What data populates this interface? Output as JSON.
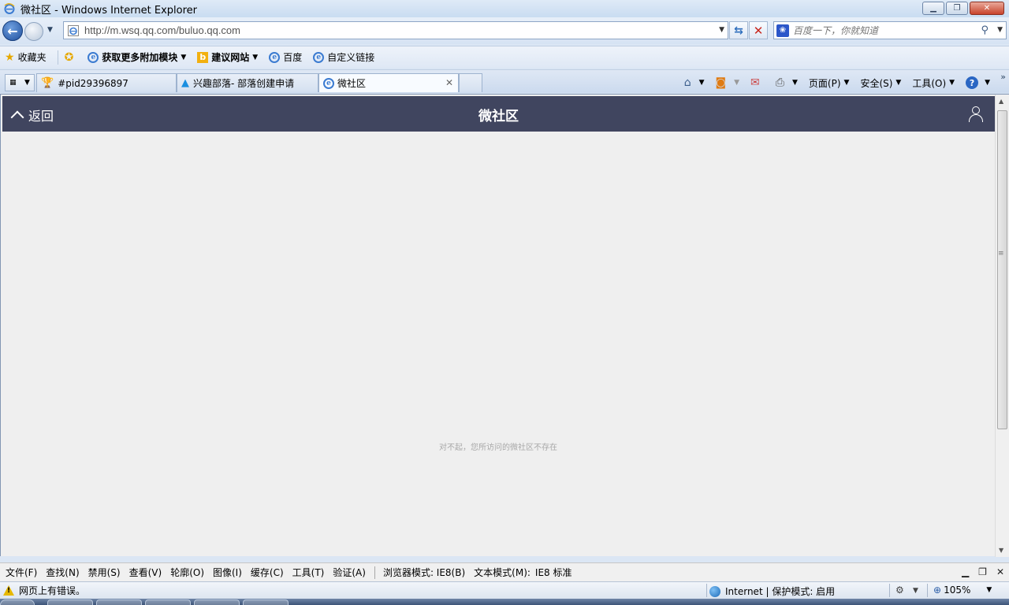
{
  "window": {
    "title": "微社区 - Windows Internet Explorer"
  },
  "address": {
    "url": "http://m.wsq.qq.com/buluo.qq.com"
  },
  "search": {
    "placeholder": "百度一下，你就知道"
  },
  "favorites": {
    "favorites_label": "收藏夹",
    "items": [
      {
        "label": "获取更多附加模块",
        "icon": "ie-page-icon"
      },
      {
        "label": "建议网站",
        "icon": "bing-icon"
      },
      {
        "label": "百度",
        "icon": "ie-page-icon"
      },
      {
        "label": "自定义链接",
        "icon": "ie-page-icon"
      }
    ]
  },
  "tabs": [
    {
      "label": "#pid29396897",
      "icon": "trophy-icon",
      "active": false
    },
    {
      "label": "兴趣部落- 部落创建申请",
      "icon": "tribe-icon",
      "active": false
    },
    {
      "label": "微社区",
      "icon": "ie-page-icon",
      "active": true
    }
  ],
  "commandbar": {
    "page_label": "页面(P)",
    "safety_label": "安全(S)",
    "tools_label": "工具(O)"
  },
  "app": {
    "back_label": "返回",
    "title": "微社区",
    "header_color": "#40455f",
    "not_found_message": "对不起，您所访问的微社区不存在"
  },
  "devtoolbar": {
    "items": [
      "文件(F)",
      "查找(N)",
      "禁用(S)",
      "查看(V)",
      "轮廓(O)",
      "图像(I)",
      "缓存(C)",
      "工具(T)",
      "验证(A)"
    ],
    "browser_mode": "浏览器模式: IE8(B)",
    "document_mode_label": "文本模式(M):",
    "document_mode_value": "IE8 标准"
  },
  "status": {
    "error_text": "网页上有错误。",
    "zone_text": "Internet | 保护模式: 启用",
    "zoom": "105%"
  }
}
